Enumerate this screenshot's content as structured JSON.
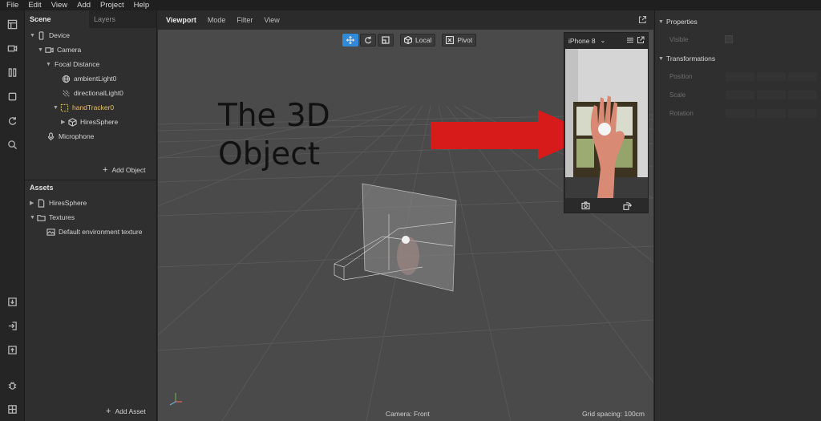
{
  "menu": [
    "File",
    "Edit",
    "View",
    "Add",
    "Project",
    "Help"
  ],
  "rail_icons": [
    "layout-icon",
    "camera-record-icon",
    "split-view-icon",
    "square-icon",
    "refresh-icon",
    "search-icon",
    "import-icon",
    "login-icon",
    "upload-icon",
    "bug-icon",
    "grid-icon"
  ],
  "scene_panel": {
    "tabs": [
      "Scene",
      "Layers"
    ],
    "tree": [
      {
        "label": "Device",
        "icon": "device-icon"
      },
      {
        "label": "Camera",
        "icon": "camera-icon"
      },
      {
        "label": "Focal Distance",
        "icon": "none"
      },
      {
        "label": "ambientLight0",
        "icon": "globe-icon"
      },
      {
        "label": "directionalLight0",
        "icon": "light-icon"
      },
      {
        "label": "handTracker0",
        "icon": "tracker-icon",
        "highlighted": true
      },
      {
        "label": "HiresSphere",
        "icon": "cube-icon"
      },
      {
        "label": "Microphone",
        "icon": "microphone-icon"
      }
    ],
    "add_object": "Add Object"
  },
  "assets_panel": {
    "title": "Assets",
    "tree": [
      {
        "label": "HiresSphere",
        "icon": "file-icon"
      },
      {
        "label": "Textures",
        "icon": "folder-icon"
      },
      {
        "label": "Default environment texture",
        "icon": "image-icon"
      }
    ],
    "add_asset": "Add Asset"
  },
  "viewport": {
    "tabs": [
      "Viewport",
      "Mode",
      "Filter",
      "View"
    ],
    "toolbar": {
      "local": "Local",
      "pivot": "Pivot"
    },
    "annotation_line1": "The 3D",
    "annotation_line2": "Object",
    "footer_camera": "Camera: Front",
    "footer_grid": "Grid spacing: 100cm",
    "arrow_color": "#d71a1a"
  },
  "phone_preview": {
    "device": "iPhone 8"
  },
  "properties": {
    "title": "Properties",
    "visible_label": "Visible",
    "transformations": "Transformations",
    "position": "Position",
    "scale": "Scale",
    "rotation": "Rotation"
  }
}
